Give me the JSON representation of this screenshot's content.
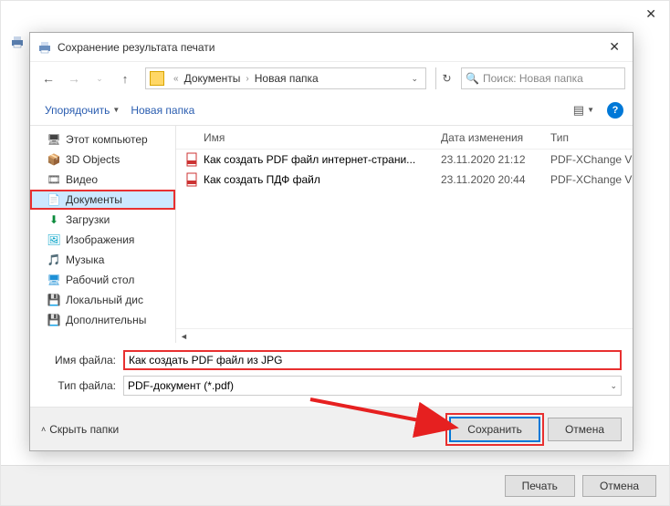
{
  "bg": {
    "print_btn": "Печать",
    "cancel_btn": "Отмена"
  },
  "dialog": {
    "title": "Сохранение результата печати",
    "addr": {
      "seg1": "Документы",
      "seg2": "Новая папка"
    },
    "search_placeholder": "Поиск: Новая папка",
    "toolbar": {
      "organize": "Упорядочить",
      "new_folder": "Новая папка"
    },
    "tree": {
      "pc": "Этот компьютер",
      "objs3d": "3D Objects",
      "video": "Видео",
      "docs": "Документы",
      "downloads": "Загрузки",
      "images": "Изображения",
      "music": "Музыка",
      "desktop": "Рабочий стол",
      "localdisk": "Локальный дис",
      "extra": "Дополнительны"
    },
    "columns": {
      "name": "Имя",
      "date": "Дата изменения",
      "type": "Тип"
    },
    "files": [
      {
        "name": "Как создать PDF файл интернет-страни...",
        "date": "23.11.2020 21:12",
        "type": "PDF-XChange V"
      },
      {
        "name": "Как создать ПДФ файл",
        "date": "23.11.2020 20:44",
        "type": "PDF-XChange V"
      }
    ],
    "form": {
      "filename_label": "Имя файла:",
      "filename_value": "Как создать PDF файл из JPG",
      "filetype_label": "Тип файла:",
      "filetype_value": "PDF-документ (*.pdf)"
    },
    "footer": {
      "hide": "Скрыть папки",
      "save": "Сохранить",
      "cancel": "Отмена"
    }
  }
}
